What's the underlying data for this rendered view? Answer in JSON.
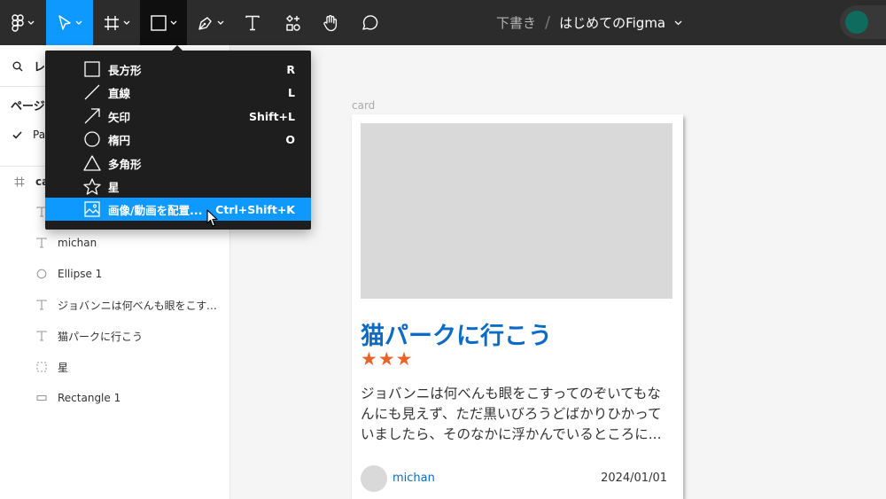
{
  "toolbar": {
    "tools": [
      "figma-menu",
      "move",
      "frame",
      "shape",
      "pen",
      "text",
      "resources",
      "hand",
      "comment"
    ]
  },
  "file": {
    "location": "下書き",
    "name": "はじめてのFigma"
  },
  "left_panel": {
    "search_label": "レ",
    "pages_label": "ページ",
    "page_item": "Pa",
    "layers": [
      {
        "icon": "frame-icon",
        "label": "ca"
      },
      {
        "icon": "text-icon",
        "label": ""
      },
      {
        "icon": "text-icon",
        "label": "michan"
      },
      {
        "icon": "ellipse-icon",
        "label": "Ellipse 1"
      },
      {
        "icon": "text-icon",
        "label": "ジョバンニは何べんも眼をこすっ..."
      },
      {
        "icon": "text-icon",
        "label": "猫パークに行こう"
      },
      {
        "icon": "component-icon",
        "label": "星"
      },
      {
        "icon": "rectangle-icon",
        "label": "Rectangle 1"
      }
    ]
  },
  "shape_menu": {
    "items": [
      {
        "icon": "rectangle-icon",
        "label": "長方形",
        "shortcut": "R"
      },
      {
        "icon": "line-icon",
        "label": "直線",
        "shortcut": "L"
      },
      {
        "icon": "arrow-icon",
        "label": "矢印",
        "shortcut": "Shift+L"
      },
      {
        "icon": "ellipse-icon",
        "label": "楕円",
        "shortcut": "O"
      },
      {
        "icon": "polygon-icon",
        "label": "多角形",
        "shortcut": ""
      },
      {
        "icon": "star-icon",
        "label": "星",
        "shortcut": ""
      },
      {
        "icon": "image-icon",
        "label": "画像/動画を配置...",
        "shortcut": "Ctrl+Shift+K",
        "highlighted": true
      }
    ]
  },
  "canvas": {
    "frame_label": "card",
    "card": {
      "title": "猫パークに行こう",
      "stars": "★★★",
      "body": "ジョバンニは何べんも眼をこすってのぞいてもなんにも見えず、ただ黒いびろうどばかりひかっていましたら、そのなかに浮かんでいるところに...",
      "author": "michan",
      "date": "2024/01/01"
    }
  },
  "colors": {
    "accent": "#0d99ff",
    "title": "#0b6bc6",
    "stars": "#e8632a",
    "toolbar": "#2c2c2c"
  }
}
